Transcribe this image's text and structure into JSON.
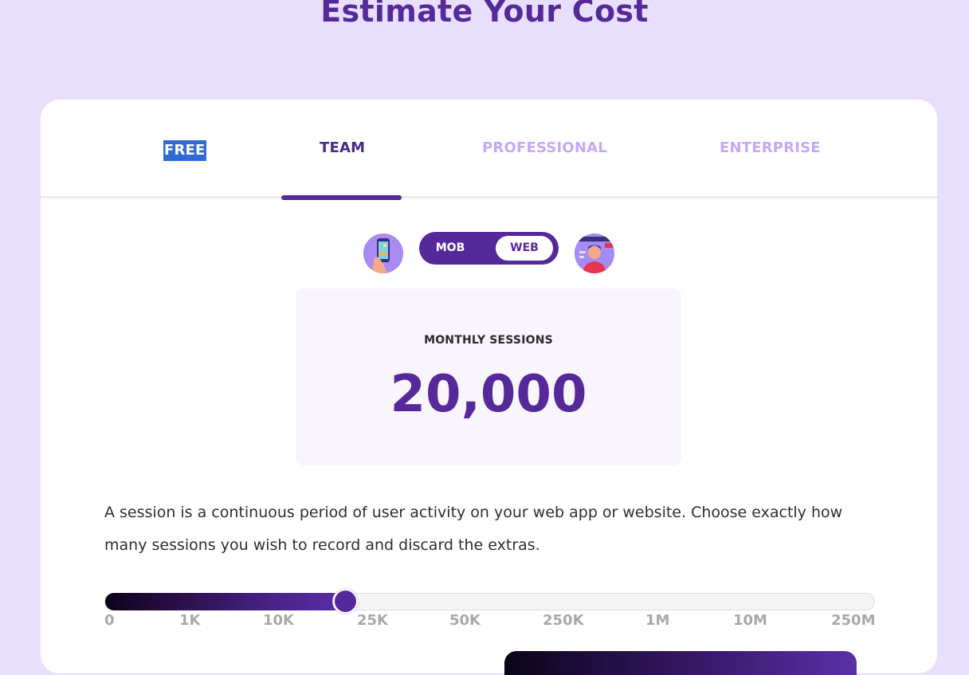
{
  "page": {
    "title": "Estimate Your Cost"
  },
  "tabs": [
    {
      "label": "FREE"
    },
    {
      "label": "TEAM"
    },
    {
      "label": "PROFESSIONAL"
    },
    {
      "label": "ENTERPRISE"
    }
  ],
  "active_tab": "TEAM",
  "platform_toggle": {
    "mob_label": "MOB",
    "web_label": "WEB",
    "selected": "WEB"
  },
  "sessions": {
    "label": "MONTHLY SESSIONS",
    "value": "20,000"
  },
  "description": "A session is a continuous period of user activity on your web app or website. Choose exactly how many sessions you wish to record and discard the extras.",
  "slider": {
    "ticks": [
      "0",
      "1K",
      "10K",
      "25K",
      "50K",
      "250K",
      "1M",
      "10M",
      "250M"
    ],
    "position_fraction": 0.31
  },
  "colors": {
    "accent": "#55299a",
    "background": "#e8dffd",
    "inactive_tab": "#c7a7f9"
  },
  "icons": {
    "mob": "mobile-phone-illustration-icon",
    "web": "web-live-stream-illustration-icon"
  }
}
